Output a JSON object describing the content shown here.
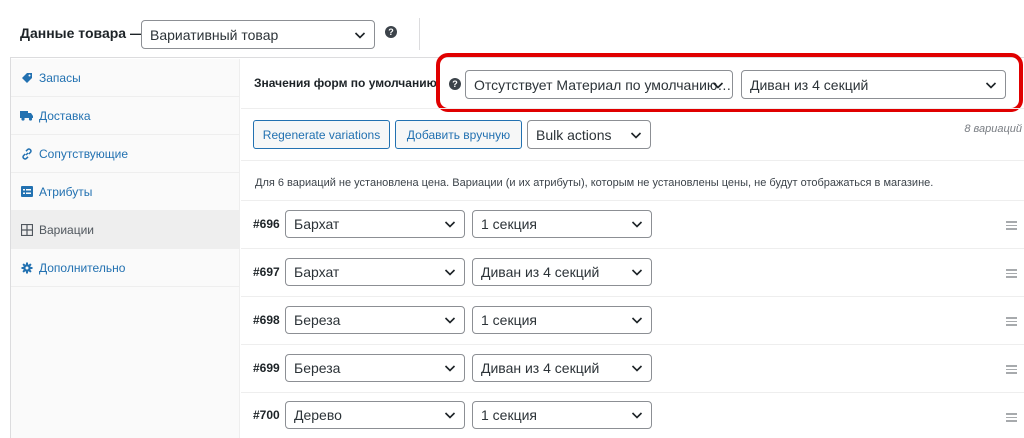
{
  "header": {
    "title": "Данные товара —",
    "product_type": "Вариативный товар"
  },
  "sidebar": {
    "items": [
      {
        "label": "Запасы",
        "icon": "tag-icon"
      },
      {
        "label": "Доставка",
        "icon": "truck-icon"
      },
      {
        "label": "Сопутствующие",
        "icon": "link-icon"
      },
      {
        "label": "Атрибуты",
        "icon": "list-icon"
      },
      {
        "label": "Вариации",
        "icon": "grid-icon",
        "active": true
      },
      {
        "label": "Дополнительно",
        "icon": "gear-icon"
      }
    ]
  },
  "defaults": {
    "label": "Значения форм по умолчанию:",
    "material_value": "Отсутствует Материал по умолчанию…",
    "sections_value": "Диван из 4 секций"
  },
  "toolbar": {
    "regenerate_label": "Regenerate variations",
    "add_manual_label": "Добавить вручную",
    "bulk_actions_value": "Bulk actions",
    "count_text": "8 вариаций"
  },
  "notice": "Для 6 вариаций не установлена цена. Вариации (и их атрибуты), которым не установлены цены, не будут отображаться в магазине.",
  "variations": [
    {
      "id": "#696",
      "material": "Бархат",
      "sections": "1 секция"
    },
    {
      "id": "#697",
      "material": "Бархат",
      "sections": "Диван из 4 секций"
    },
    {
      "id": "#698",
      "material": "Береза",
      "sections": "1 секция"
    },
    {
      "id": "#699",
      "material": "Береза",
      "sections": "Диван из 4 секций"
    },
    {
      "id": "#700",
      "material": "Дерево",
      "sections": "1 секция"
    }
  ],
  "colors": {
    "accent": "#2271b1",
    "highlight": "#e00000"
  }
}
